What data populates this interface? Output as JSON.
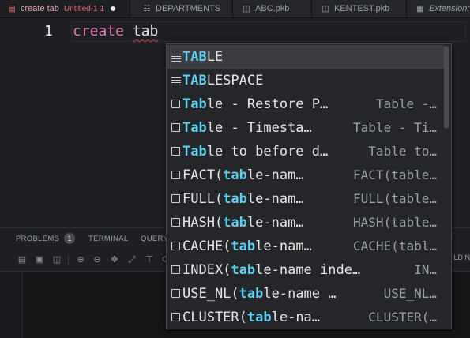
{
  "tabs": [
    {
      "title": "create tab",
      "subtitle": "Untitled-1 1",
      "modified": true,
      "active": true,
      "icon": "sql-file-icon"
    },
    {
      "title": "DEPARTMENTS",
      "icon": "table-icon"
    },
    {
      "title": "ABC.pkb",
      "icon": "database-icon"
    },
    {
      "title": "KENTEST.pkb",
      "icon": "database-icon"
    },
    {
      "title": "Extension:",
      "icon": "extensions-icon"
    }
  ],
  "editor": {
    "line_number": "1",
    "keyword": "create",
    "identifier": "tab"
  },
  "suggestions": [
    {
      "pre": "",
      "hl": "TAB",
      "post": "LE",
      "detail": "",
      "icon": "snippet-icon",
      "selected": true
    },
    {
      "pre": "",
      "hl": "TAB",
      "post": "LESPACE",
      "detail": "",
      "icon": "snippet-icon"
    },
    {
      "pre": "",
      "hl": "Tab",
      "post": "le - Restore P…",
      "detail": "Table -…",
      "icon": "box-icon"
    },
    {
      "pre": "",
      "hl": "Tab",
      "post": "le - Timesta…",
      "detail": "Table - Ti…",
      "icon": "box-icon"
    },
    {
      "pre": "",
      "hl": "Tab",
      "post": "le to before d…",
      "detail": "Table to…",
      "icon": "box-icon"
    },
    {
      "pre": "FACT(",
      "hl": "tab",
      "post": "le-nam…",
      "detail": "FACT(table…",
      "icon": "box-icon"
    },
    {
      "pre": "FULL(",
      "hl": "tab",
      "post": "le-nam…",
      "detail": "FULL(table…",
      "icon": "box-icon"
    },
    {
      "pre": "HASH(",
      "hl": "tab",
      "post": "le-nam…",
      "detail": "HASH(table…",
      "icon": "box-icon"
    },
    {
      "pre": "CACHE(",
      "hl": "tab",
      "post": "le-nam…",
      "detail": "CACHE(tabl…",
      "icon": "box-icon"
    },
    {
      "pre": "INDEX(",
      "hl": "tab",
      "post": "le-name inde…",
      "detail": "IN…",
      "icon": "box-icon"
    },
    {
      "pre": "USE_NL(",
      "hl": "tab",
      "post": "le-name …",
      "detail": "USE_NL…",
      "icon": "box-icon"
    },
    {
      "pre": "CLUSTER(",
      "hl": "tab",
      "post": "le-na…",
      "detail": "CLUSTER(…",
      "icon": "box-icon"
    }
  ],
  "panel": {
    "tabs": [
      {
        "label": "PROBLEMS",
        "badge": "1"
      },
      {
        "label": "TERMINAL"
      },
      {
        "label": "QUERY"
      }
    ],
    "right_label": "LD N",
    "right_label_top": "E"
  },
  "colors": {
    "keyword": "#e07bb0",
    "highlight": "#5fd0f0",
    "background": "#1e1f22",
    "popup": "#252629",
    "tab_modified": "#e06c75"
  }
}
